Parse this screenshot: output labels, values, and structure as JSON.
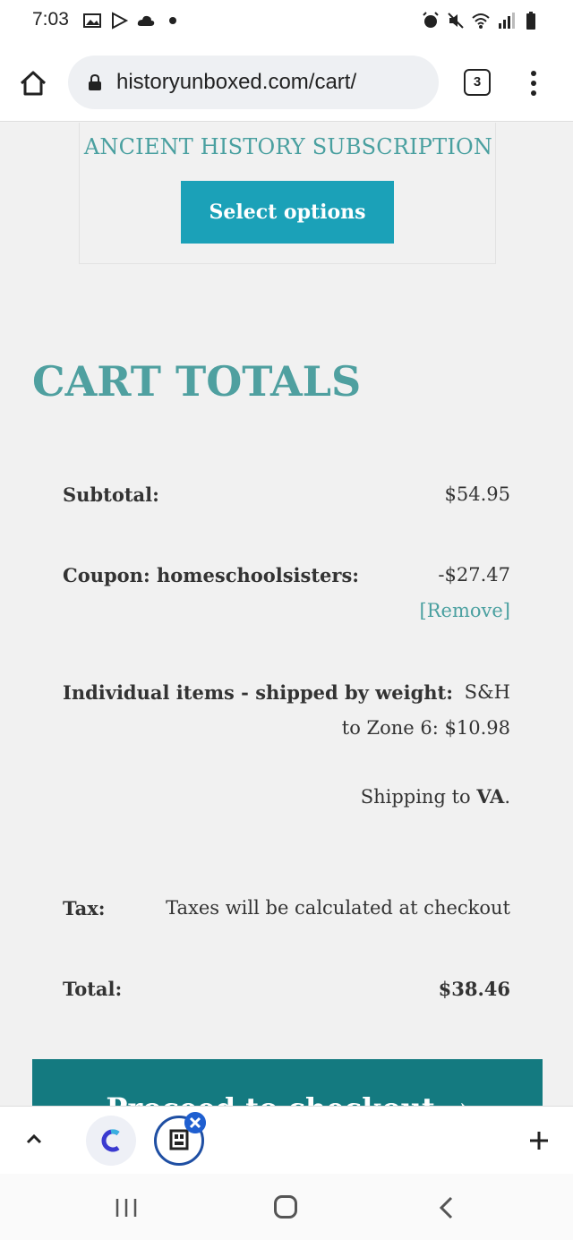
{
  "status_bar": {
    "time": "7:03",
    "left_icons": [
      "image-icon",
      "play-store-icon",
      "cloud-icon",
      "dot-icon"
    ],
    "right_icons": [
      "alarm-icon",
      "mute-icon",
      "wifi-icon",
      "signal-icon",
      "battery-icon"
    ]
  },
  "browser": {
    "url": "historyunboxed.com/cart/",
    "tab_count": "3"
  },
  "product": {
    "title": "ANCIENT HISTORY SUBSCRIPTION",
    "button_label": "Select options"
  },
  "cart_totals": {
    "heading": "CART TOTALS",
    "subtotal_label": "Subtotal:",
    "subtotal_value": "$54.95",
    "coupon_label": "Coupon: homeschoolsisters:",
    "coupon_value": "-$27.47",
    "coupon_remove": "[Remove]",
    "shipping_label": "Individual items - shipped by weight:",
    "shipping_value_line1": "S&H",
    "shipping_value_line2": "to Zone 6: $10.98",
    "shipping_to_prefix": "Shipping to ",
    "shipping_to_state": "VA",
    "shipping_to_suffix": ".",
    "tax_label": "Tax:",
    "tax_value": "Taxes will be calculated at checkout",
    "total_label": "Total:",
    "total_value": "$38.46",
    "checkout_label": "Proceed to checkout →"
  },
  "colors": {
    "accent_teal": "#4fa0a0",
    "button_blue": "#1ba1b8",
    "checkout_teal": "#147a80"
  }
}
